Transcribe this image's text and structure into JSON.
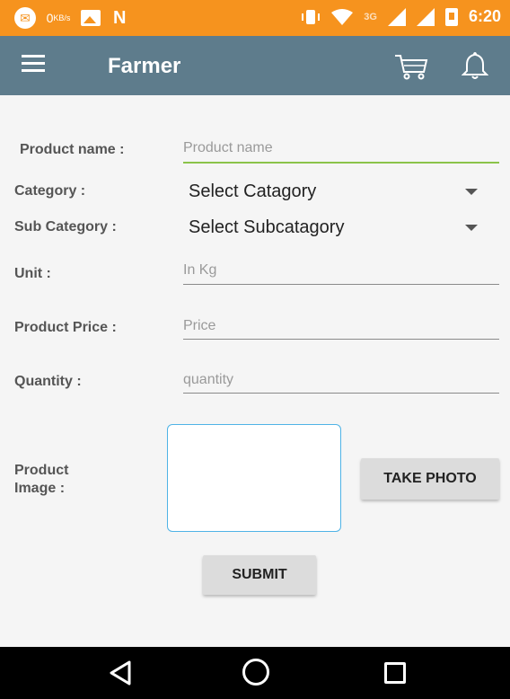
{
  "status_bar": {
    "speed_value": "0",
    "speed_unit": "KB/s",
    "network_3g": "3G",
    "time": "6:20"
  },
  "app_bar": {
    "title": "Farmer"
  },
  "form": {
    "product_name": {
      "label": "Product name :",
      "placeholder": "Product name"
    },
    "category": {
      "label": "Category :",
      "selected": "Select Catagory"
    },
    "sub_category": {
      "label": "Sub Category :",
      "selected": "Select Subcatagory"
    },
    "unit": {
      "label": "Unit :",
      "placeholder": "In Kg"
    },
    "price": {
      "label": "Product Price :",
      "placeholder": "Price"
    },
    "quantity": {
      "label": "Quantity :",
      "placeholder": "quantity"
    },
    "image": {
      "label_line1": "Product",
      "label_line2": "Image :"
    },
    "take_photo_label": "TAKE PHOTO",
    "submit_label": "SUBMIT"
  },
  "colors": {
    "status_bar": "#f6931e",
    "app_bar": "#5e7c8c",
    "focus_underline": "#8bc34a",
    "image_border": "#4fb3e6"
  }
}
